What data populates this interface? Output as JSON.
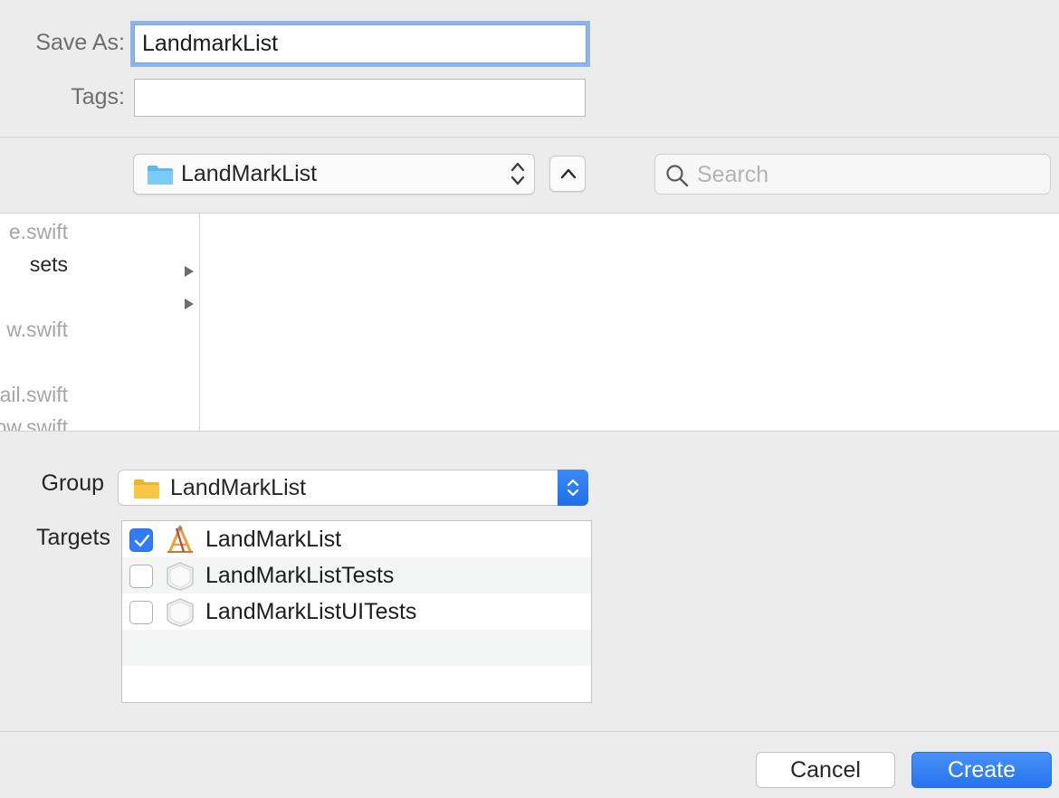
{
  "form": {
    "save_as_label": "Save As:",
    "save_as_value": "LandmarkList",
    "tags_label": "Tags:",
    "tags_value": ""
  },
  "toolbar": {
    "location": "LandMarkList",
    "search_placeholder": "Search"
  },
  "browser": {
    "column1": [
      {
        "label": "e.swift",
        "disabled": true,
        "folder": false
      },
      {
        "label": "sets",
        "disabled": false,
        "folder": true
      },
      {
        "label": "",
        "disabled": false,
        "folder": true
      },
      {
        "label": "w.swift",
        "disabled": true,
        "folder": false
      },
      {
        "label": "",
        "disabled": true,
        "folder": false
      },
      {
        "label": "etail.swift",
        "disabled": true,
        "folder": false
      },
      {
        "label": "ow.swift",
        "disabled": true,
        "folder": false
      }
    ]
  },
  "group": {
    "label": "Group",
    "value": "LandMarkList"
  },
  "targets": {
    "label": "Targets",
    "items": [
      {
        "name": "LandMarkList",
        "checked": true,
        "icon": "app-icon"
      },
      {
        "name": "LandMarkListTests",
        "checked": false,
        "icon": "test-bundle-icon"
      },
      {
        "name": "LandMarkListUITests",
        "checked": false,
        "icon": "test-bundle-icon"
      }
    ]
  },
  "buttons": {
    "cancel": "Cancel",
    "create": "Create"
  },
  "colors": {
    "accent": "#2f7cf6",
    "window_bg": "#ececec",
    "folder_blue": "#5cb6f2",
    "folder_yellow": "#f7c645"
  }
}
